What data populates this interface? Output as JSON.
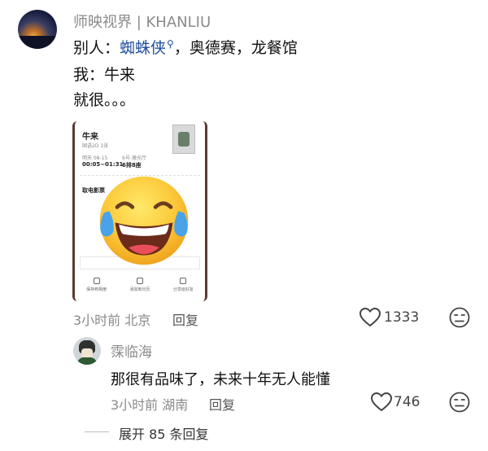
{
  "post": {
    "username": "师映视界 | KHANLIU",
    "line1_prefix": "别人：",
    "line1_link": "蜘蛛侠",
    "line1_suffix": "，奥德赛，龙餐馆",
    "line2": "我：牛来",
    "line3": "就很。。。",
    "time": "3小时前",
    "location": "北京",
    "reply_label": "回复",
    "likes": "1333"
  },
  "screenshot": {
    "movie": "牛来",
    "sub": "国语2D 1张",
    "date": "明天 08-15",
    "hall": "6号-激光厅",
    "time": "00:05~01:31",
    "seat": "6排8座",
    "pickup": "取电影票",
    "actions": [
      "保存到相册",
      "添加到日历",
      "分享给好友"
    ]
  },
  "reply": {
    "username": "霂临海",
    "text": "那很有品味了，未来十年无人能懂",
    "time": "3小时前",
    "location": "湖南",
    "reply_label": "回复",
    "likes": "746"
  },
  "expand": {
    "label": "展开 85 条回复"
  },
  "colors": {
    "link": "#1f4e9c",
    "muted": "#8a8a8a"
  }
}
